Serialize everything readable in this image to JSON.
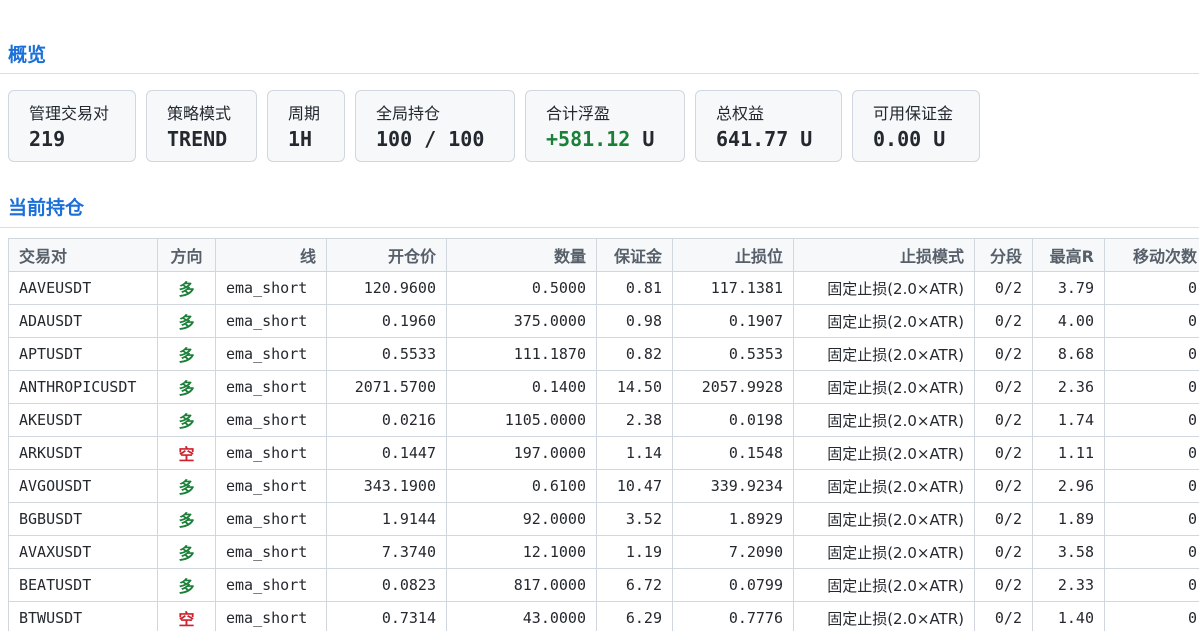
{
  "overview": {
    "title": "概览",
    "cards": [
      {
        "label": "管理交易对",
        "value": "219"
      },
      {
        "label": "策略模式",
        "value": "TREND"
      },
      {
        "label": "周期",
        "value": "1H"
      },
      {
        "label": "全局持仓",
        "value": "100 / 100"
      },
      {
        "label": "合计浮盈",
        "value": "+581.12",
        "unit": " U"
      },
      {
        "label": "总权益",
        "value": "641.77 U"
      },
      {
        "label": "可用保证金",
        "value": "0.00 U"
      }
    ]
  },
  "positions": {
    "title": "当前持仓",
    "headers": [
      "交易对",
      "方向",
      "线",
      "开仓价",
      "数量",
      "保证金",
      "止损位",
      "止损模式",
      "分段",
      "最高R",
      "移动次数"
    ],
    "rows": [
      [
        "AAVEUSDT",
        "多",
        "ema_short",
        "120.9600",
        "0.5000",
        "0.81",
        "117.1381",
        "固定止损(2.0×ATR)",
        "0/2",
        "3.79",
        "0"
      ],
      [
        "ADAUSDT",
        "多",
        "ema_short",
        "0.1960",
        "375.0000",
        "0.98",
        "0.1907",
        "固定止损(2.0×ATR)",
        "0/2",
        "4.00",
        "0"
      ],
      [
        "APTUSDT",
        "多",
        "ema_short",
        "0.5533",
        "111.1870",
        "0.82",
        "0.5353",
        "固定止损(2.0×ATR)",
        "0/2",
        "8.68",
        "0"
      ],
      [
        "ANTHROPICUSDT",
        "多",
        "ema_short",
        "2071.5700",
        "0.1400",
        "14.50",
        "2057.9928",
        "固定止损(2.0×ATR)",
        "0/2",
        "2.36",
        "0"
      ],
      [
        "AKEUSDT",
        "多",
        "ema_short",
        "0.0216",
        "1105.0000",
        "2.38",
        "0.0198",
        "固定止损(2.0×ATR)",
        "0/2",
        "1.74",
        "0"
      ],
      [
        "ARKUSDT",
        "空",
        "ema_short",
        "0.1447",
        "197.0000",
        "1.14",
        "0.1548",
        "固定止损(2.0×ATR)",
        "0/2",
        "1.11",
        "0"
      ],
      [
        "AVGOUSDT",
        "多",
        "ema_short",
        "343.1900",
        "0.6100",
        "10.47",
        "339.9234",
        "固定止损(2.0×ATR)",
        "0/2",
        "2.96",
        "0"
      ],
      [
        "BGBUSDT",
        "多",
        "ema_short",
        "1.9144",
        "92.0000",
        "3.52",
        "1.8929",
        "固定止损(2.0×ATR)",
        "0/2",
        "1.89",
        "0"
      ],
      [
        "AVAXUSDT",
        "多",
        "ema_short",
        "7.3740",
        "12.1000",
        "1.19",
        "7.2090",
        "固定止损(2.0×ATR)",
        "0/2",
        "3.58",
        "0"
      ],
      [
        "BEATUSDT",
        "多",
        "ema_short",
        "0.0823",
        "817.0000",
        "6.72",
        "0.0799",
        "固定止损(2.0×ATR)",
        "0/2",
        "2.33",
        "0"
      ],
      [
        "BTWUSDT",
        "空",
        "ema_short",
        "0.7314",
        "43.0000",
        "6.29",
        "0.7776",
        "固定止损(2.0×ATR)",
        "0/2",
        "1.40",
        "0"
      ]
    ]
  },
  "colors": {
    "accent": "#1a6fd8",
    "long": "#1a7f37",
    "short": "#cf222e",
    "positive": "#1a7f37"
  }
}
